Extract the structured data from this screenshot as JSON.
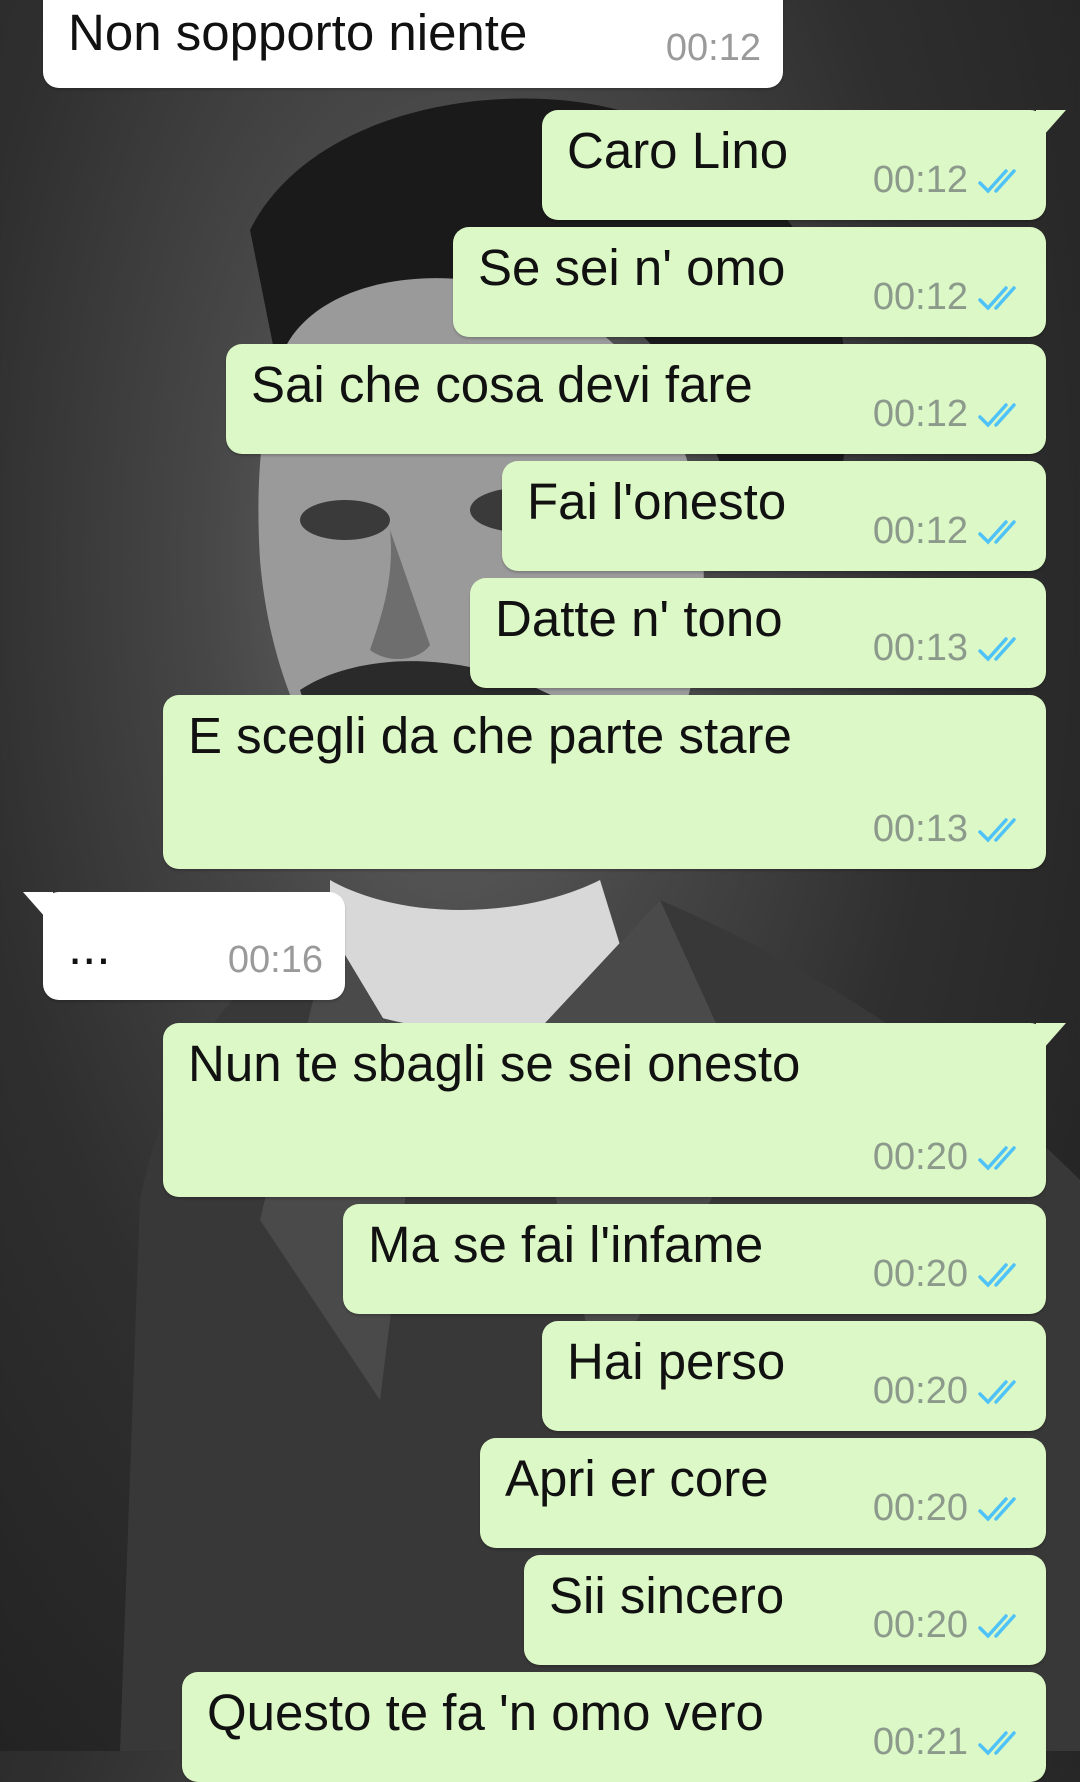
{
  "messages": [
    {
      "direction": "in",
      "text": "Non sopporto niente",
      "time": "00:12"
    },
    {
      "direction": "out",
      "text": "Caro Lino",
      "time": "00:12",
      "status": "read"
    },
    {
      "direction": "out",
      "text": "Se sei n' omo",
      "time": "00:12",
      "status": "read"
    },
    {
      "direction": "out",
      "text": "Sai che cosa devi fare",
      "time": "00:12",
      "status": "read"
    },
    {
      "direction": "out",
      "text": "Fai l'onesto",
      "time": "00:12",
      "status": "read"
    },
    {
      "direction": "out",
      "text": "Datte n' tono",
      "time": "00:13",
      "status": "read"
    },
    {
      "direction": "out",
      "text": "E scegli da che parte stare",
      "time": "00:13",
      "status": "read"
    },
    {
      "direction": "in",
      "text": "...",
      "time": "00:16"
    },
    {
      "direction": "out",
      "text": "Nun te sbagli se sei onesto",
      "time": "00:20",
      "status": "read"
    },
    {
      "direction": "out",
      "text": "Ma se fai l'infame",
      "time": "00:20",
      "status": "read"
    },
    {
      "direction": "out",
      "text": "Hai perso",
      "time": "00:20",
      "status": "read"
    },
    {
      "direction": "out",
      "text": "Apri er core",
      "time": "00:20",
      "status": "read"
    },
    {
      "direction": "out",
      "text": "Sii sincero",
      "time": "00:20",
      "status": "read"
    },
    {
      "direction": "out",
      "text": "Questo te fa 'n omo vero",
      "time": "00:21",
      "status": "read"
    }
  ],
  "colors": {
    "outgoing_bubble": "#dcf8c6",
    "incoming_bubble": "#ffffff",
    "read_ticks": "#4fc3f7",
    "timestamp": "#8c9a8c"
  },
  "icons": {
    "read_receipt": "double-check-icon"
  }
}
